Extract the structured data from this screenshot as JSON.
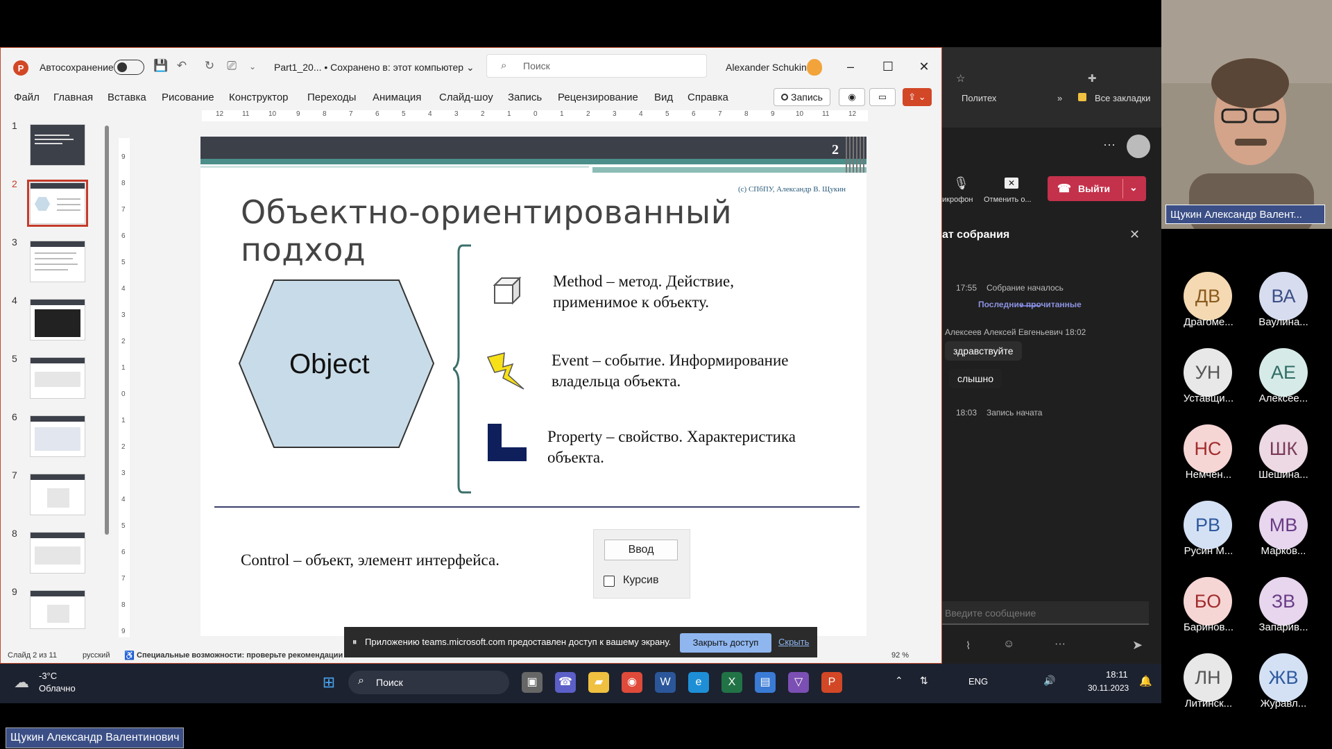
{
  "ppt": {
    "autosave_label": "Автосохранение",
    "doc_title": "Part1_20... • Сохранено в: этот компьютер ⌄",
    "search_placeholder": "Поиск",
    "user_name": "Alexander Schukin",
    "menu": [
      "Файл",
      "Главная",
      "Вставка",
      "Рисование",
      "Конструктор",
      "Переходы",
      "Анимация",
      "Слайд-шоу",
      "Запись",
      "Рецензирование",
      "Вид",
      "Справка"
    ],
    "record_label": "Запись",
    "thumb_numbers": [
      "1",
      "2",
      "3",
      "4",
      "5",
      "6",
      "7",
      "8",
      "9"
    ],
    "hruler": [
      "12",
      "11",
      "10",
      "9",
      "8",
      "7",
      "6",
      "5",
      "4",
      "3",
      "2",
      "1",
      "0",
      "1",
      "2",
      "3",
      "4",
      "5",
      "6",
      "7",
      "8",
      "9",
      "10",
      "11",
      "12"
    ],
    "vruler": [
      "9",
      "8",
      "7",
      "6",
      "5",
      "4",
      "3",
      "2",
      "1",
      "0",
      "1",
      "2",
      "3",
      "4",
      "5",
      "6",
      "7",
      "8",
      "9"
    ],
    "status_slide": "Слайд 2 из 11",
    "status_lang": "русский",
    "status_access": "Специальные возможности: проверьте рекомендации",
    "zoom": "92 %"
  },
  "slide": {
    "number": "2",
    "copyright": "(c) СПбПУ, Александр В. Щукин",
    "title": "Объектно-ориентированный подход",
    "object_label": "Object",
    "method_text": "Method – метод. Действие, применимое к объекту.",
    "event_text": "Event – событие. Информирование владельца объекта.",
    "property_text": "Property – свойство. Характеристика объекта.",
    "control_text": "Control – объект, элемент интерфейса.",
    "demo_button": "Ввод",
    "demo_checkbox": "Курсив"
  },
  "banner": {
    "message": "Приложению teams.microsoft.com предоставлен доступ к вашему экрану.",
    "stop_label": "Закрыть доступ",
    "hide_label": "Скрыть"
  },
  "teams": {
    "bookmark_1": "Политех",
    "bookmark_all": "Все закладки",
    "mic_label": "икрофон",
    "cancel_label": "Отменить о...",
    "leave_label": "Выйти",
    "chat_title": "ат собрания",
    "ev1_time": "17:55",
    "ev1_text": "Собрание началось",
    "last_read": "Последние прочитанные",
    "sender": "Алексеев Алексей Евгеньевич  18:02",
    "msg1": "здравствуйте",
    "msg2": "слышно",
    "ev2_time": "18:03",
    "ev2_text": "Запись начата",
    "input_placeholder": "Введите сообщение"
  },
  "participants": {
    "cam_name": "Щукин Александр Валент...",
    "list": [
      {
        "initials": "ДВ",
        "name": "Драгоме...",
        "bg": "#f4d9b2",
        "fg": "#8a5a1e"
      },
      {
        "initials": "ВА",
        "name": "Ваулина...",
        "bg": "#d7dcef",
        "fg": "#3b4f86"
      },
      {
        "initials": "УН",
        "name": "Уставщи...",
        "bg": "#e8e8e8",
        "fg": "#555555"
      },
      {
        "initials": "АЕ",
        "name": "Алексее...",
        "bg": "#d6ebe8",
        "fg": "#2f6b63"
      },
      {
        "initials": "НС",
        "name": "Немчен...",
        "bg": "#f6d5d5",
        "fg": "#a12c2c"
      },
      {
        "initials": "ШК",
        "name": "Шешина...",
        "bg": "#ecd9e3",
        "fg": "#7a3a5a"
      },
      {
        "initials": "РВ",
        "name": "Русин М...",
        "bg": "#d4e1f5",
        "fg": "#2e5a9e"
      },
      {
        "initials": "МВ",
        "name": "Марков...",
        "bg": "#e7d6ee",
        "fg": "#6a3c86"
      },
      {
        "initials": "БО",
        "name": "Баринов...",
        "bg": "#f6d5d5",
        "fg": "#a12c2c"
      },
      {
        "initials": "ЗВ",
        "name": "Запарив...",
        "bg": "#e7d6ee",
        "fg": "#6a3c86"
      },
      {
        "initials": "ЛН",
        "name": "Литинск...",
        "bg": "#e8e8e8",
        "fg": "#555555"
      },
      {
        "initials": "ЖВ",
        "name": "Журавл...",
        "bg": "#d4e1f5",
        "fg": "#2e5a9e"
      }
    ]
  },
  "taskbar": {
    "temp": "-3°C",
    "weather": "Облачно",
    "search": "Поиск",
    "lang": "ENG",
    "time": "18:11",
    "date": "30.11.2023"
  },
  "presenter_name": "Щукин Александр Валентинович",
  "colors": {
    "accent_ppt": "#d24726",
    "slide_dark": "#3c4049",
    "slide_teal": "#4c8e8a",
    "hex_fill": "#c8dbe8",
    "leave_red": "#c4314b"
  }
}
